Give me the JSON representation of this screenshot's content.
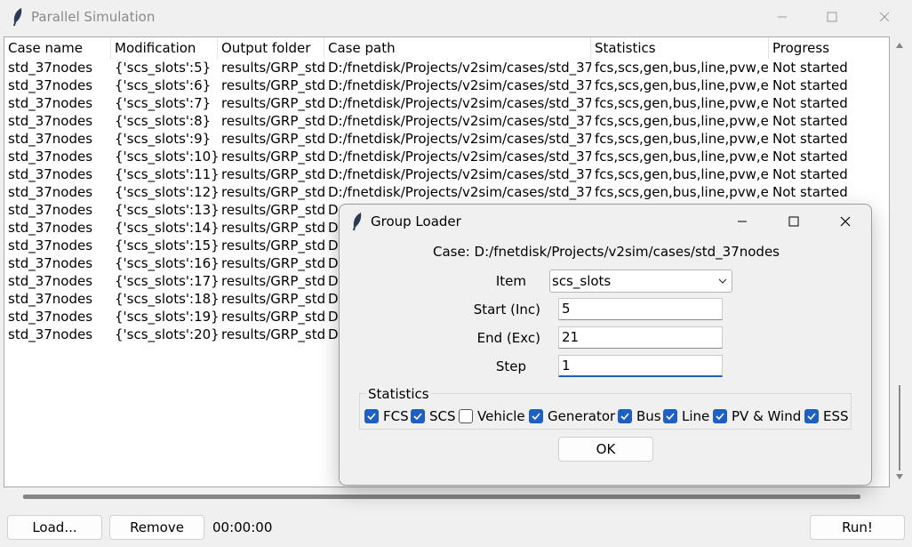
{
  "window": {
    "title": "Parallel Simulation",
    "accent": "#1f5fc2"
  },
  "table": {
    "columns": [
      "Case name",
      "Modification",
      "Output folder",
      "Case path",
      "Statistics",
      "Progress"
    ],
    "rows": [
      [
        "std_37nodes",
        "{'scs_slots':5}",
        "results/GRP_std",
        "D:/fnetdisk/Projects/v2sim/cases/std_37",
        "fcs,scs,gen,bus,line,pvw,es",
        "Not started"
      ],
      [
        "std_37nodes",
        "{'scs_slots':6}",
        "results/GRP_std",
        "D:/fnetdisk/Projects/v2sim/cases/std_37",
        "fcs,scs,gen,bus,line,pvw,es",
        "Not started"
      ],
      [
        "std_37nodes",
        "{'scs_slots':7}",
        "results/GRP_std",
        "D:/fnetdisk/Projects/v2sim/cases/std_37",
        "fcs,scs,gen,bus,line,pvw,es",
        "Not started"
      ],
      [
        "std_37nodes",
        "{'scs_slots':8}",
        "results/GRP_std",
        "D:/fnetdisk/Projects/v2sim/cases/std_37",
        "fcs,scs,gen,bus,line,pvw,es",
        "Not started"
      ],
      [
        "std_37nodes",
        "{'scs_slots':9}",
        "results/GRP_std",
        "D:/fnetdisk/Projects/v2sim/cases/std_37",
        "fcs,scs,gen,bus,line,pvw,es",
        "Not started"
      ],
      [
        "std_37nodes",
        "{'scs_slots':10}",
        "results/GRP_std",
        "D:/fnetdisk/Projects/v2sim/cases/std_37",
        "fcs,scs,gen,bus,line,pvw,es",
        "Not started"
      ],
      [
        "std_37nodes",
        "{'scs_slots':11}",
        "results/GRP_std",
        "D:/fnetdisk/Projects/v2sim/cases/std_37",
        "fcs,scs,gen,bus,line,pvw,es",
        "Not started"
      ],
      [
        "std_37nodes",
        "{'scs_slots':12}",
        "results/GRP_std",
        "D:/fnetdisk/Projects/v2sim/cases/std_37",
        "fcs,scs,gen,bus,line,pvw,es",
        "Not started"
      ],
      [
        "std_37nodes",
        "{'scs_slots':13}",
        "results/GRP_std",
        "D",
        "",
        ""
      ],
      [
        "std_37nodes",
        "{'scs_slots':14}",
        "results/GRP_std",
        "D",
        "",
        ""
      ],
      [
        "std_37nodes",
        "{'scs_slots':15}",
        "results/GRP_std",
        "D",
        "",
        ""
      ],
      [
        "std_37nodes",
        "{'scs_slots':16}",
        "results/GRP_std",
        "D",
        "",
        ""
      ],
      [
        "std_37nodes",
        "{'scs_slots':17}",
        "results/GRP_std",
        "D",
        "",
        ""
      ],
      [
        "std_37nodes",
        "{'scs_slots':18}",
        "results/GRP_std",
        "D",
        "",
        ""
      ],
      [
        "std_37nodes",
        "{'scs_slots':19}",
        "results/GRP_std",
        "D",
        "",
        ""
      ],
      [
        "std_37nodes",
        "{'scs_slots':20}",
        "results/GRP_std",
        "D",
        "",
        ""
      ]
    ]
  },
  "bottom": {
    "load_label": "Load...",
    "remove_label": "Remove",
    "timer": "00:00:00",
    "run_label": "Run!"
  },
  "dialog": {
    "title": "Group Loader",
    "case_text": "Case: D:/fnetdisk/Projects/v2sim/cases/std_37nodes",
    "item_label": "Item",
    "item_value": "scs_slots",
    "start_label": "Start (Inc)",
    "start_value": "5",
    "end_label": "End (Exc)",
    "end_value": "21",
    "step_label": "Step",
    "step_value": "1",
    "stats_legend": "Statistics",
    "checkboxes": [
      {
        "label": "FCS",
        "checked": true
      },
      {
        "label": "SCS",
        "checked": true
      },
      {
        "label": "Vehicle",
        "checked": false
      },
      {
        "label": "Generator",
        "checked": true
      },
      {
        "label": "Bus",
        "checked": true
      },
      {
        "label": "Line",
        "checked": true
      },
      {
        "label": "PV & Wind",
        "checked": true
      },
      {
        "label": "ESS",
        "checked": true
      }
    ],
    "ok_label": "OK"
  }
}
